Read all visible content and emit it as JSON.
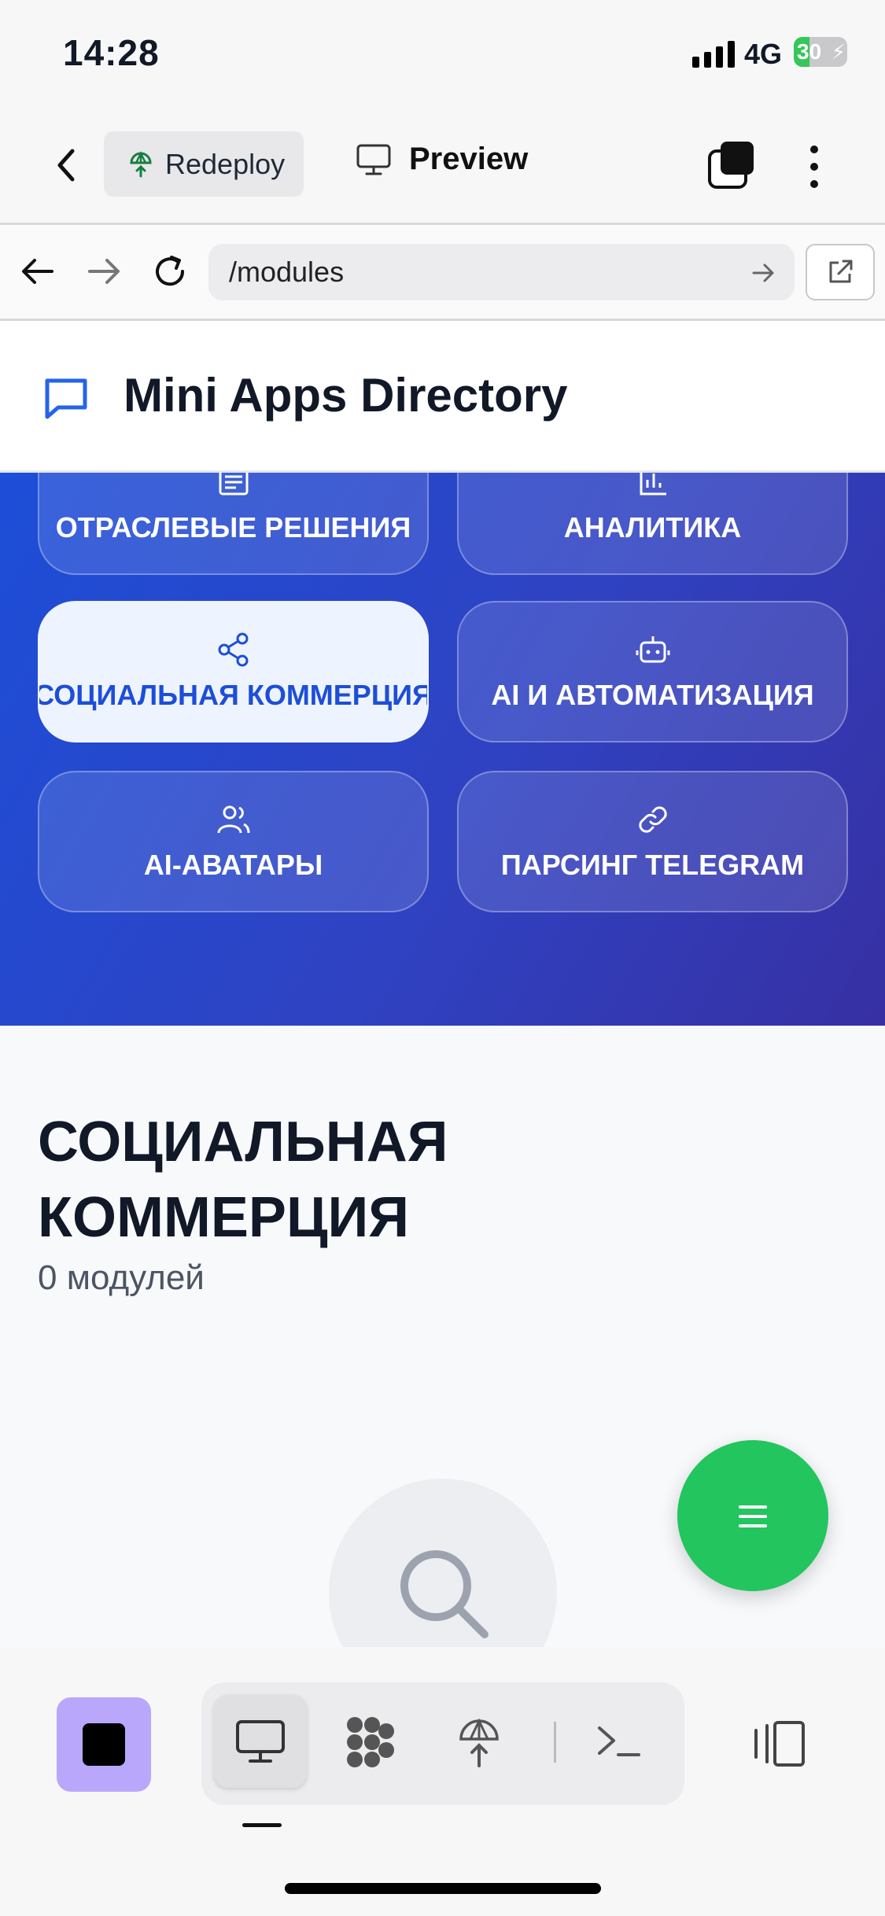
{
  "status_bar": {
    "time": "14:28",
    "network": "4G",
    "battery": "30"
  },
  "toolbar": {
    "redeploy_label": "Redeploy",
    "preview_label": "Preview"
  },
  "address_bar": {
    "url": "/modules"
  },
  "site": {
    "title": "Mini Apps Directory"
  },
  "categories": [
    {
      "label": "ОТРАСЛЕВЫЕ РЕШЕНИЯ",
      "icon": "newspaper-icon",
      "active": false
    },
    {
      "label": "АНАЛИТИКА",
      "icon": "bar-chart-icon",
      "active": false
    },
    {
      "label": "СОЦИАЛЬНАЯ КОММЕРЦИЯ",
      "icon": "share-icon",
      "active": true
    },
    {
      "label": "AI И АВТОМАТИЗАЦИЯ",
      "icon": "robot-icon",
      "active": false
    },
    {
      "label": "AI-АВАТАРЫ",
      "icon": "users-icon",
      "active": false
    },
    {
      "label": "ПАРСИНГ TELEGRAM",
      "icon": "link-icon",
      "active": false
    }
  ],
  "section": {
    "title_line1": "СОЦИАЛЬНАЯ",
    "title_line2": "КОММЕРЦИЯ",
    "count": "0 модулей"
  },
  "colors": {
    "hero_start": "#1d4ed8",
    "hero_end": "#3730a3",
    "fab": "#22c55e",
    "stop": "#b9a7fb"
  }
}
